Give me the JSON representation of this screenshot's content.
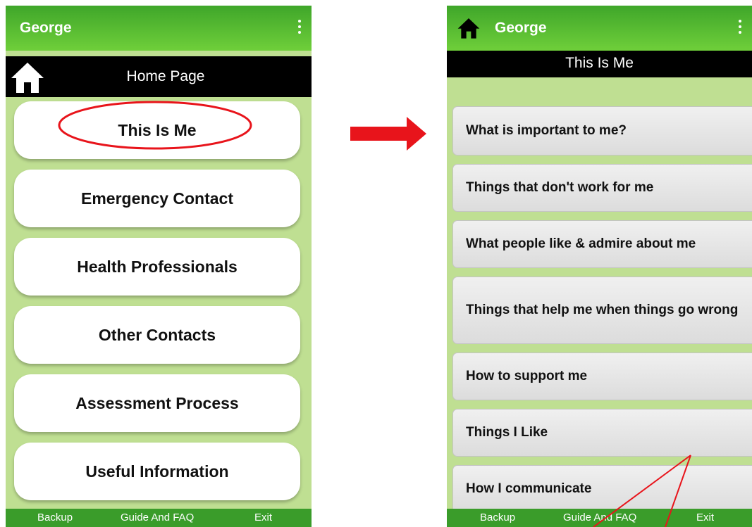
{
  "left_screen": {
    "app_title": "George",
    "page_title": "Home Page",
    "buttons": [
      "This Is Me",
      "Emergency Contact",
      "Health Professionals",
      "Other Contacts",
      "Assessment Process",
      "Useful Information"
    ],
    "footer": {
      "backup": "Backup",
      "guide": "Guide And FAQ",
      "exit": "Exit"
    }
  },
  "right_screen": {
    "app_title": "George",
    "page_title": "This Is Me",
    "items": [
      "What is important to me?",
      "Things that don't work for me",
      "What people like & admire about me",
      "Things that help me when things go wrong",
      "How to support me",
      "Things I Like",
      "How I communicate"
    ],
    "footer": {
      "backup": "Backup",
      "guide": "Guide And FAQ",
      "exit": "Exit"
    }
  },
  "colors": {
    "appbar_green": "#4cb830",
    "background_green": "#bfdf92",
    "annotation_red": "#e8141b"
  },
  "icons": [
    "home-icon",
    "more-vert-icon",
    "arrow-right-icon"
  ]
}
